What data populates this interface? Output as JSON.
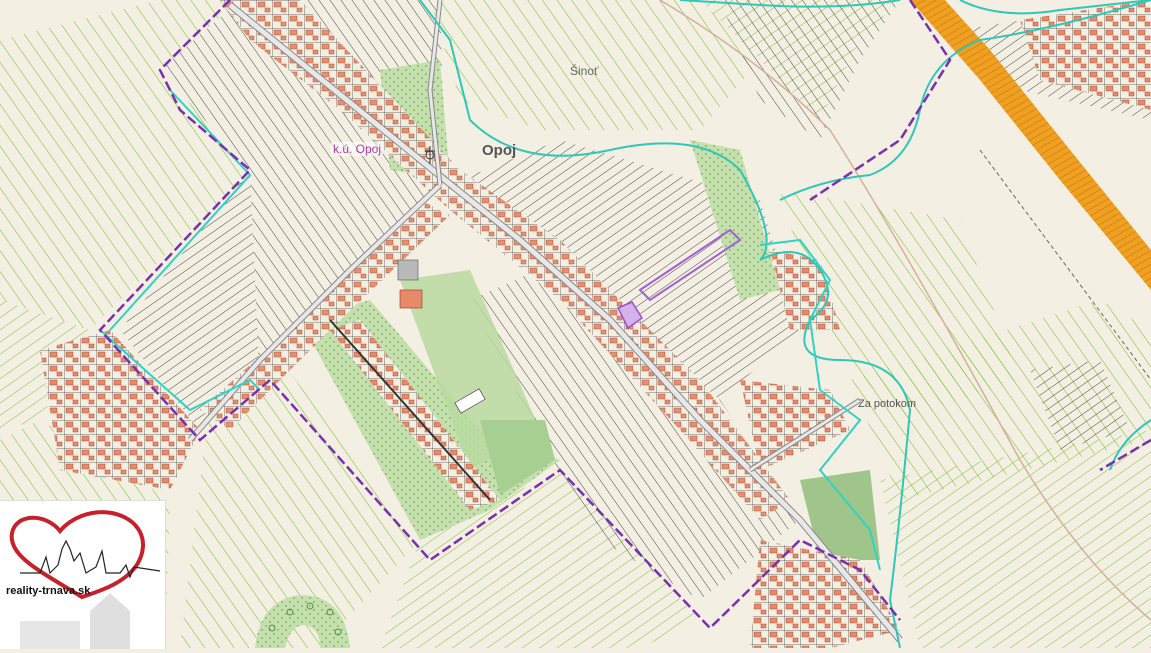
{
  "map": {
    "labels": {
      "cadastral_area": "k.ú. Opoj",
      "village": "Opoj",
      "locality_north": "Šinoť",
      "locality_east": "Za potokom"
    }
  },
  "logo": {
    "text": "reality-trnava.sk"
  },
  "colors": {
    "background": "#f3efe3",
    "parcel_lines": "#1a1a1a",
    "field_lines": "#6cbf1a",
    "boundary": "#7a2fb0",
    "stream": "#2fc7b8",
    "buildings": "#e88a6a",
    "green_area": "#b8d9a0",
    "railway": "#f0a020",
    "label_purple": "#b03aa8",
    "logo_heart": "#c8202a"
  }
}
